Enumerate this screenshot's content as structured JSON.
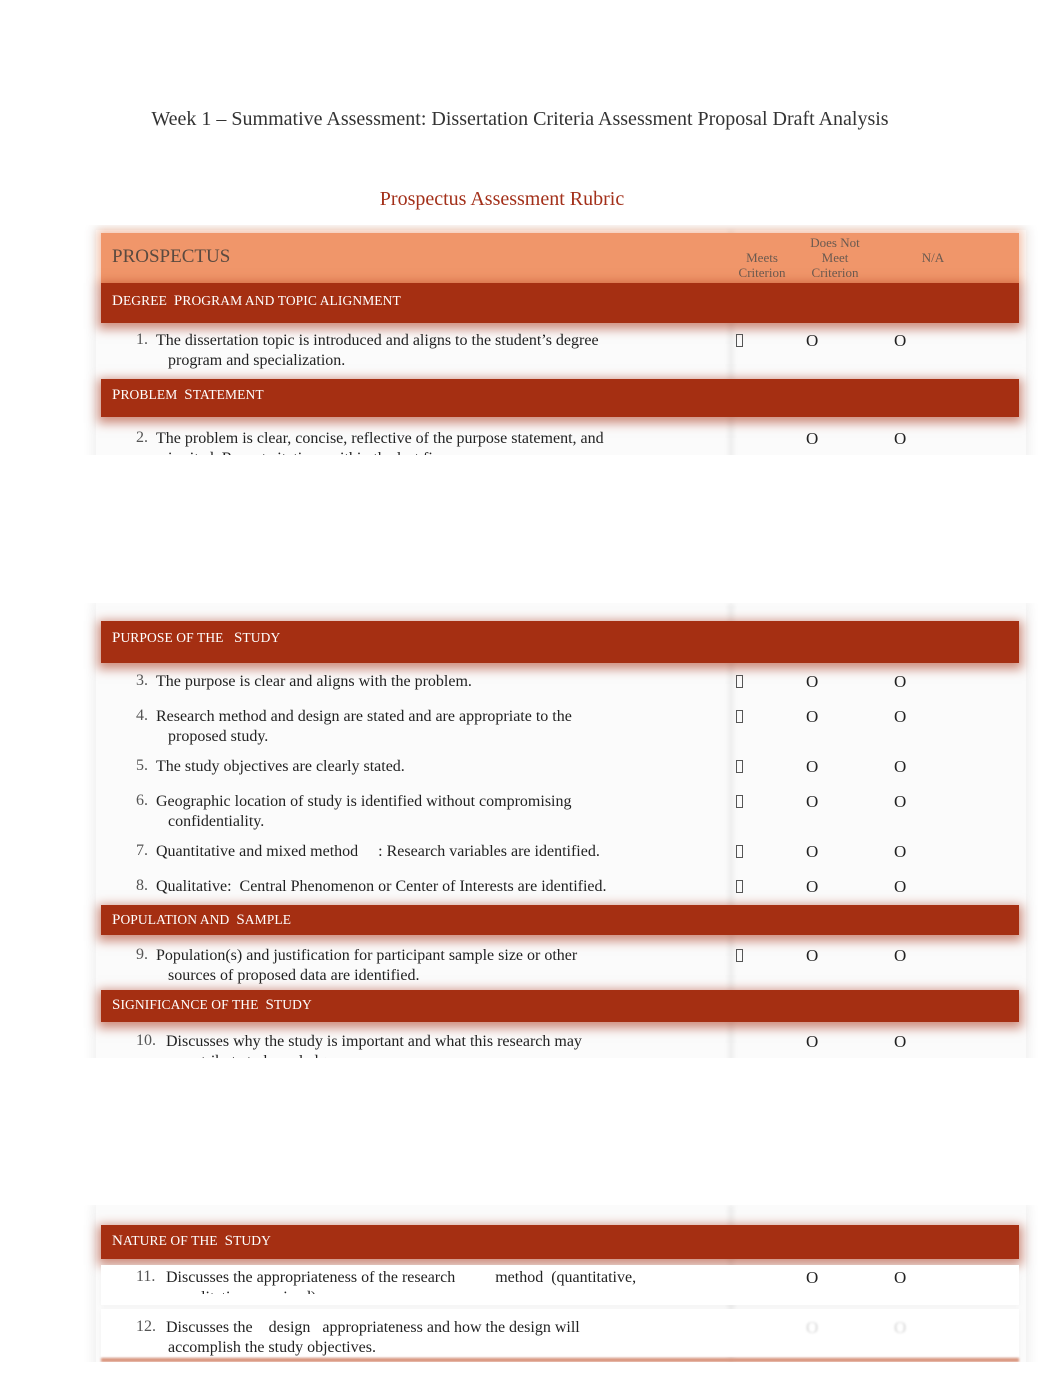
{
  "document": {
    "title": "Week 1 – Summative Assessment: Dissertation Criteria Assessment Proposal Draft Analysis",
    "rubric_title": "Prospectus Assessment Rubric"
  },
  "table": {
    "header": {
      "label": "PROSPECTUS",
      "columns": [
        {
          "line1": "",
          "line2": "Meets",
          "line3": "Criterion"
        },
        {
          "line1": "Does Not",
          "line2": "Meet",
          "line3": "Criterion"
        },
        {
          "line1": "",
          "line2": "N/A",
          "line3": ""
        }
      ]
    },
    "radio_glyph": "O",
    "sections": [
      {
        "first": "D",
        "rest": "EGREE",
        "first2": "P",
        "rest2": "ROGRAM AND TOPIC ALIGNMENT"
      },
      {
        "first": "P",
        "rest": "ROBLEM",
        "first2": "S",
        "rest2": "TATEMENT"
      },
      {
        "first": "P",
        "rest": "URPOSE OF THE",
        "first2": "S",
        "rest2": "TUDY"
      },
      {
        "first": "P",
        "rest": "OPULATION AND",
        "first2": "S",
        "rest2": "AMPLE"
      },
      {
        "first": "S",
        "rest": "IGNIFICANCE OF THE",
        "first2": "S",
        "rest2": "TUDY"
      },
      {
        "first": "N",
        "rest": "ATURE OF THE",
        "first2": "S",
        "rest2": "TUDY"
      }
    ],
    "items": [
      {
        "num": "1.",
        "line1": "The dissertation topic is introduced and aligns to the student’s degree",
        "line2": "program and specialization.",
        "meets_checkbox": true
      },
      {
        "num": "2.",
        "line1": "The problem is clear, concise, reflective of the purpose statement, and",
        "line2": "is cited. Recent citations within the last five",
        "meets_checkbox": false
      },
      {
        "num": "3.",
        "line1": "The purpose is clear and aligns with the problem.",
        "line2": "",
        "meets_checkbox": true
      },
      {
        "num": "4.",
        "line1": "Research method and design are stated and are appropriate to the",
        "line2": "proposed study.",
        "meets_checkbox": true
      },
      {
        "num": "5.",
        "line1": "The study objectives are clearly stated.",
        "line2": "",
        "meets_checkbox": true
      },
      {
        "num": "6.",
        "line1": "Geographic location of study is identified without compromising",
        "line2": "confidentiality.",
        "meets_checkbox": true
      },
      {
        "num": "7.",
        "line1": "Quantitative and mixed method     : Research variables are identified.",
        "line2": "",
        "meets_checkbox": true
      },
      {
        "num": "8.",
        "line1": "Qualitative:  Central Phenomenon or Center of Interests are identified.",
        "line2": "",
        "meets_checkbox": true
      },
      {
        "num": "9.",
        "line1": "Population(s) and justification for participant sample size or other",
        "line2": "sources of proposed data are identified.",
        "meets_checkbox": true
      },
      {
        "num": "10.",
        "line1": "Discusses why the study is important and what this research may",
        "line2": "contribute to knowledge.",
        "meets_checkbox": false
      },
      {
        "num": "11.",
        "line1": "Discusses the appropriateness of the research          method  (quantitative,",
        "line2": "qualitative, or mixed).",
        "meets_checkbox": false
      },
      {
        "num": "12.",
        "line1": "Discusses the    design   appropriateness and how the design will",
        "line2": "accomplish the study objectives.",
        "meets_checkbox": false
      }
    ]
  }
}
